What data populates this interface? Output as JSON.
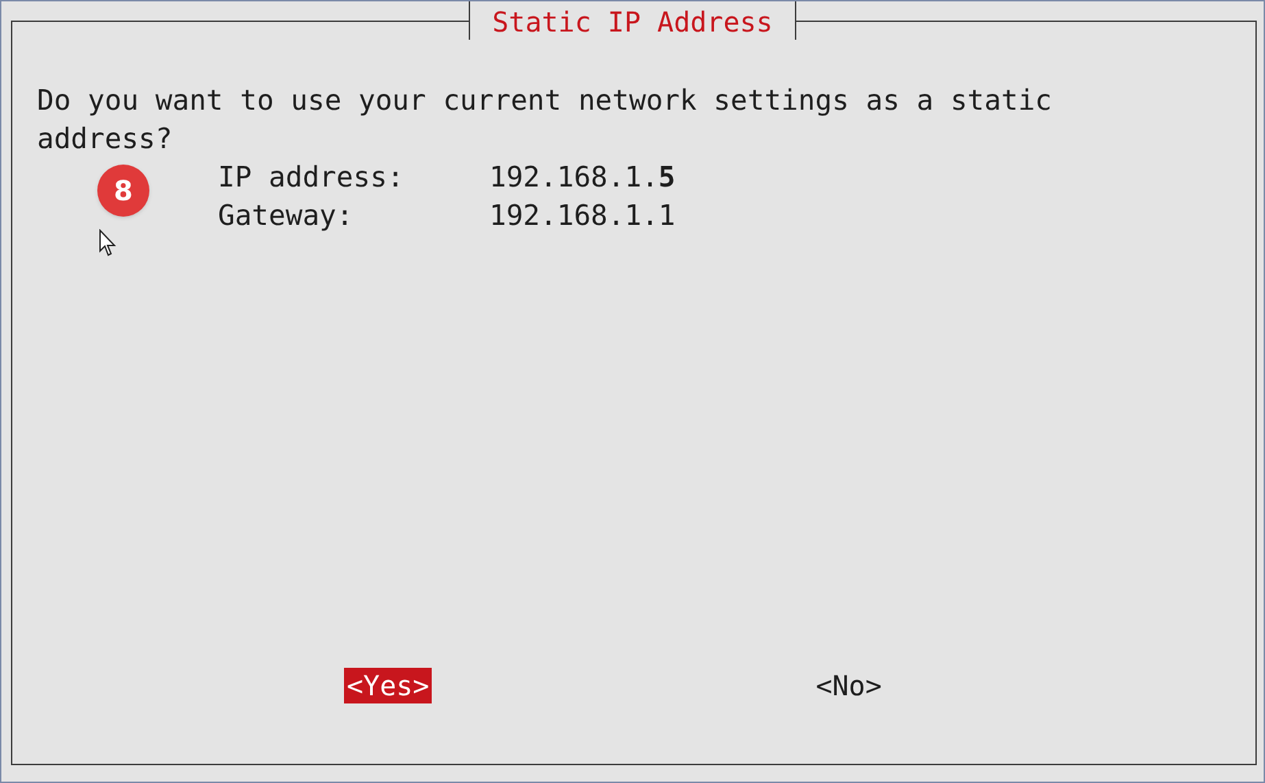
{
  "dialog": {
    "title": "Static IP Address",
    "message": "Do you want to use your current network settings as a static address?",
    "step_badge": "8",
    "fields": [
      {
        "label": "IP address:",
        "value": "192.168.1.**5**"
      },
      {
        "label": "Gateway:",
        "value": "192.168.1.1"
      }
    ],
    "buttons": [
      {
        "label": "<Yes>",
        "selected": true
      },
      {
        "label": "<No>",
        "selected": false
      }
    ]
  }
}
